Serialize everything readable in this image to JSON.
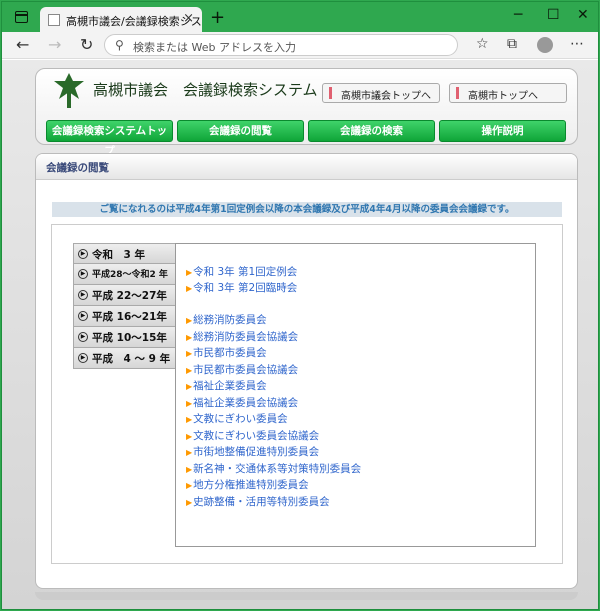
{
  "browser": {
    "tab_title": "高槻市議会/会議録検索システム",
    "address_placeholder": "検索または Web アドレスを入力"
  },
  "header": {
    "site_title": "高槻市議会　会議録検索システム",
    "top_buttons": [
      "高槻市議会トップへ",
      "高槻市トップへ"
    ],
    "nav_buttons": [
      "会議録検索システムトップ",
      "会議録の閲覧",
      "会議録の検索",
      "操作説明"
    ]
  },
  "content": {
    "heading": "会議録の閲覧",
    "notice": "ご覧になれるのは平成4年第1回定例会以降の本会議録及び平成4年4月以降の委員会会議録です。",
    "eras": [
      "令和　3 年",
      "平成28～令和2 年",
      "平成 22～27年",
      "平成 16～21年",
      "平成 10～15年",
      "平成　4 ～ 9 年"
    ],
    "sessions": [
      "令和 3年 第1回定例会",
      "令和 3年 第2回臨時会"
    ],
    "committees": [
      "総務消防委員会",
      "総務消防委員会協議会",
      "市民都市委員会",
      "市民都市委員会協議会",
      "福祉企業委員会",
      "福祉企業委員会協議会",
      "文教にぎわい委員会",
      "文教にぎわい委員会協議会",
      "市街地整備促進特別委員会",
      "新名神・交通体系等対策特別委員会",
      "地方分権推進特別委員会",
      "史跡整備・活用等特別委員会"
    ]
  }
}
